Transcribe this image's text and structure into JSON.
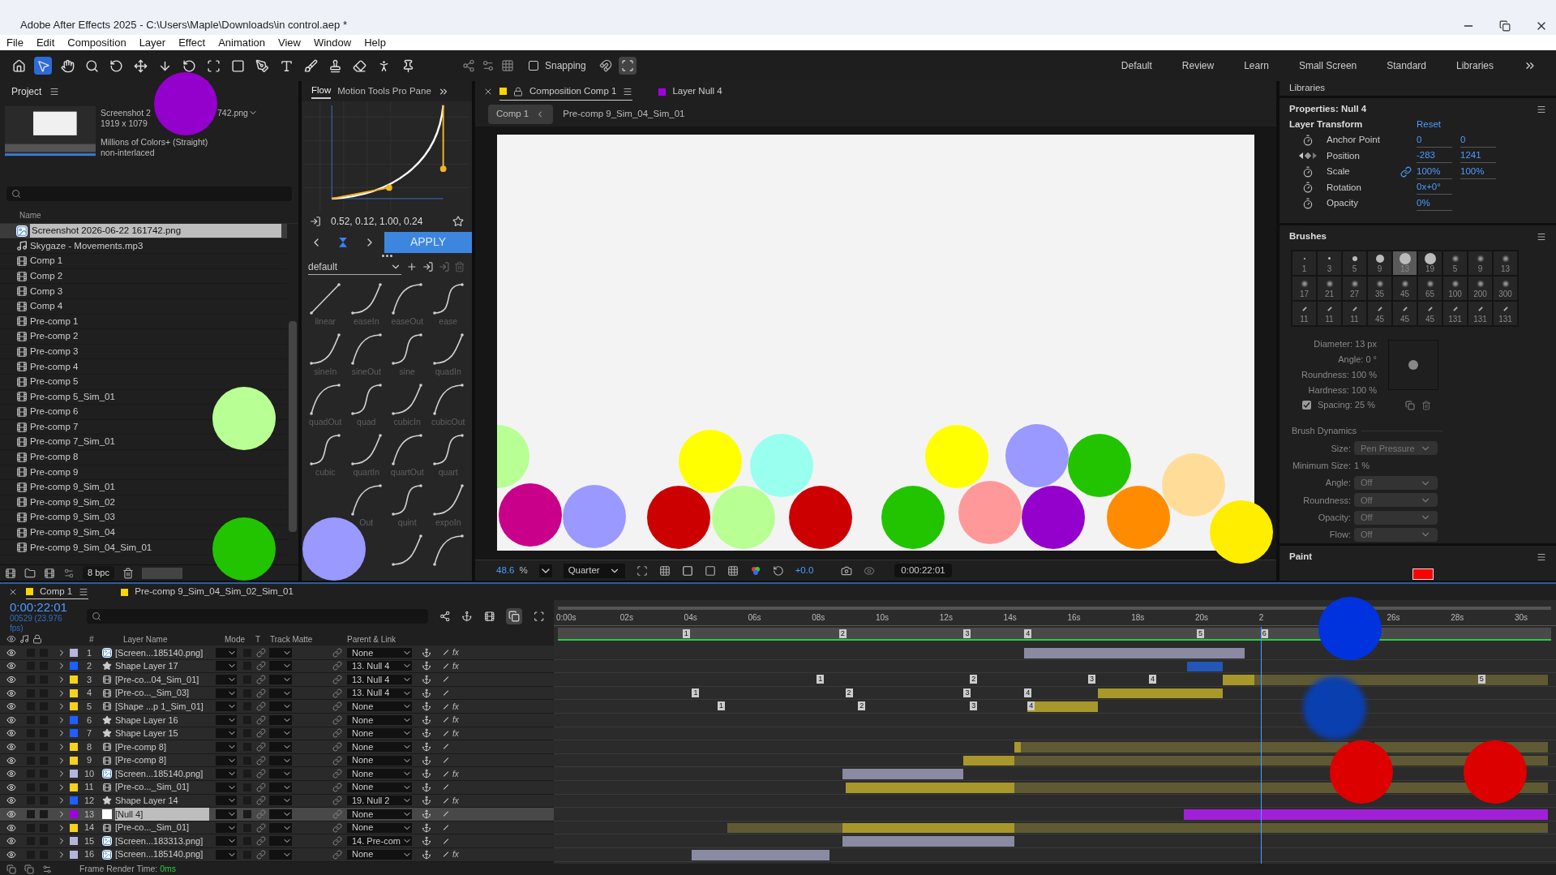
{
  "window": {
    "title": "Adobe After Effects 2025 - C:\\Users\\Maple\\Downloads\\in control.aep *"
  },
  "menu": [
    "File",
    "Edit",
    "Composition",
    "Layer",
    "Effect",
    "Animation",
    "View",
    "Window",
    "Help"
  ],
  "toolbar": {
    "snapping": {
      "label": "Snapping",
      "checked": false
    },
    "workspaces": [
      "Default",
      "Review",
      "Learn",
      "Small Screen",
      "Standard",
      "Libraries"
    ]
  },
  "project": {
    "title": "Project",
    "preview": {
      "name_start": "Screenshot 2",
      "name_end": "742.png",
      "dims": "1919 x 1079",
      "colors": "Millions of Colors+ (Straight)",
      "interlace": "non-interlaced"
    },
    "column": "Name",
    "bpc": "8 bpc",
    "items": [
      {
        "name": "Screenshot 2026-06-22 161742.png",
        "kind": "image",
        "selected": true
      },
      {
        "name": "Skygaze - Movements.mp3",
        "kind": "audio",
        "selected": false
      },
      {
        "name": "Comp 1",
        "kind": "comp",
        "selected": false
      },
      {
        "name": "Comp 2",
        "kind": "comp",
        "selected": false
      },
      {
        "name": "Comp 3",
        "kind": "comp",
        "selected": false
      },
      {
        "name": "Comp 4",
        "kind": "comp",
        "selected": false
      },
      {
        "name": "Pre-comp 1",
        "kind": "comp",
        "selected": false
      },
      {
        "name": "Pre-comp 2",
        "kind": "comp",
        "selected": false
      },
      {
        "name": "Pre-comp 3",
        "kind": "comp",
        "selected": false
      },
      {
        "name": "Pre-comp 4",
        "kind": "comp",
        "selected": false
      },
      {
        "name": "Pre-comp 5",
        "kind": "comp",
        "selected": false
      },
      {
        "name": "Pre-comp 5_Sim_01",
        "kind": "comp",
        "selected": false
      },
      {
        "name": "Pre-comp 6",
        "kind": "comp",
        "selected": false
      },
      {
        "name": "Pre-comp 7",
        "kind": "comp",
        "selected": false
      },
      {
        "name": "Pre-comp 7_Sim_01",
        "kind": "comp",
        "selected": false
      },
      {
        "name": "Pre-comp 8",
        "kind": "comp",
        "selected": false
      },
      {
        "name": "Pre-comp 9",
        "kind": "comp",
        "selected": false
      },
      {
        "name": "Pre-comp 9_Sim_01",
        "kind": "comp",
        "selected": false
      },
      {
        "name": "Pre-comp 9_Sim_02",
        "kind": "comp",
        "selected": false
      },
      {
        "name": "Pre-comp 9_Sim_03",
        "kind": "comp",
        "selected": false
      },
      {
        "name": "Pre-comp 9_Sim_04",
        "kind": "comp",
        "selected": false
      },
      {
        "name": "Pre-comp 9_Sim_04_Sim_01",
        "kind": "comp",
        "selected": false
      }
    ]
  },
  "flow": {
    "tabs": [
      {
        "label": "Flow",
        "selected": true
      },
      {
        "label": "Motion Tools Pro Pane",
        "selected": false
      }
    ],
    "values": "0.52, 0.12, 1.00, 0.24",
    "apply": "APPLY",
    "preset": "default",
    "presets": [
      "linear",
      "easeIn",
      "easeOut",
      "ease",
      "sineIn",
      "sineOut",
      "sine",
      "quadIn",
      "quadOut",
      "quad",
      "cubicIn",
      "cubicOut",
      "cubic",
      "quartIn",
      "quartOut",
      "quart",
      "Out",
      "quint",
      "expoIn"
    ]
  },
  "composition": {
    "tabs": [
      {
        "label": "Composition Comp 1",
        "color": "#ffd400",
        "selected": true
      },
      {
        "label": "Layer Null 4",
        "color": "#a100e0",
        "selected": false
      }
    ],
    "breadcrumbs": [
      "Comp 1",
      "Pre-comp 9_Sim_04_Sim_01"
    ],
    "zoom": "48.6",
    "zoom_unit": "%",
    "resolution": "Quarter",
    "exposure": "+0.0",
    "timecode": "0:00:22:01"
  },
  "right_panel": {
    "libraries": "Libraries",
    "properties": {
      "title": "Properties: Null 4",
      "section": "Layer Transform",
      "reset": "Reset",
      "rows": [
        {
          "label": "Anchor Point",
          "kind": "stopwatch",
          "values": [
            "0",
            "0"
          ],
          "linked": false
        },
        {
          "label": "Position",
          "kind": "keyframe",
          "values": [
            "-283",
            "1241"
          ],
          "linked": false
        },
        {
          "label": "Scale",
          "kind": "stopwatch",
          "values": [
            "100%",
            "100%"
          ],
          "linked": true
        },
        {
          "label": "Rotation",
          "kind": "stopwatch",
          "values": [
            "0x+0°"
          ],
          "linked": false
        },
        {
          "label": "Opacity",
          "kind": "stopwatch",
          "values": [
            "0%"
          ],
          "linked": false
        }
      ]
    },
    "brushes": {
      "title": "Brushes",
      "tips": [
        {
          "label": "1",
          "kind": "hard",
          "selected": false
        },
        {
          "label": "3",
          "kind": "hard",
          "selected": false
        },
        {
          "label": "5",
          "kind": "hard",
          "selected": false
        },
        {
          "label": "9",
          "kind": "hard",
          "selected": false
        },
        {
          "label": "13",
          "kind": "hard",
          "selected": true
        },
        {
          "label": "19",
          "kind": "hard",
          "selected": false
        },
        {
          "label": "5",
          "kind": "soft",
          "selected": false
        },
        {
          "label": "9",
          "kind": "soft",
          "selected": false
        },
        {
          "label": "13",
          "kind": "soft",
          "selected": false
        },
        {
          "label": "17",
          "kind": "soft",
          "selected": false
        },
        {
          "label": "21",
          "kind": "soft",
          "selected": false
        },
        {
          "label": "27",
          "kind": "soft",
          "selected": false
        },
        {
          "label": "35",
          "kind": "soft",
          "selected": false
        },
        {
          "label": "45",
          "kind": "soft",
          "selected": false
        },
        {
          "label": "65",
          "kind": "soft",
          "selected": false
        },
        {
          "label": "100",
          "kind": "soft",
          "selected": false
        },
        {
          "label": "200",
          "kind": "soft",
          "selected": false
        },
        {
          "label": "300",
          "kind": "soft",
          "selected": false
        },
        {
          "label": "11",
          "kind": "angled",
          "selected": false
        },
        {
          "label": "11",
          "kind": "angled",
          "selected": false
        },
        {
          "label": "11",
          "kind": "angled",
          "selected": false
        },
        {
          "label": "45",
          "kind": "angled",
          "selected": false
        },
        {
          "label": "45",
          "kind": "angled",
          "selected": false
        },
        {
          "label": "45",
          "kind": "angled",
          "selected": false
        },
        {
          "label": "131",
          "kind": "angled",
          "selected": false
        },
        {
          "label": "131",
          "kind": "angled",
          "selected": false
        },
        {
          "label": "131",
          "kind": "angled",
          "selected": false
        }
      ],
      "settings": [
        "Diameter: 13 px",
        "Angle: 0 °",
        "Roundness: 100 %",
        "Hardness: 100 %"
      ],
      "spacing": {
        "label": "Spacing: 25 %",
        "checked": true
      },
      "dynamics_title": "Brush Dynamics",
      "dynamics": [
        {
          "label": "Size:",
          "value": "Pen Pressure",
          "kind": "select"
        },
        {
          "label": "Minimum Size:",
          "value": "1 %",
          "kind": "text"
        },
        {
          "label": "Angle:",
          "value": "Off",
          "kind": "select"
        },
        {
          "label": "Roundness:",
          "value": "Off",
          "kind": "select"
        },
        {
          "label": "Opacity:",
          "value": "Off",
          "kind": "select"
        },
        {
          "label": "Flow:",
          "value": "Off",
          "kind": "select"
        }
      ]
    },
    "paint": {
      "title": "Paint",
      "color": "#ff0000"
    }
  },
  "timeline": {
    "tabs": [
      {
        "label": "Comp 1",
        "color": "#ffd400",
        "selected": true
      },
      {
        "label": "Pre-comp 9_Sim_04_Sim_02_Sim_01",
        "color": "#ffd400",
        "selected": false
      }
    ],
    "timecode": "0:00:22:01",
    "frame": "00529 (23.976 fps)",
    "columns": {
      "num": "#",
      "name": "Layer Name",
      "mode": "Mode",
      "t": "T",
      "matte": "Track Matte",
      "parent": "Parent & Link"
    },
    "ruler": [
      "0:00s",
      "02s",
      "04s",
      "06s",
      "08s",
      "10s",
      "12s",
      "14s",
      "16s",
      "18s",
      "20s",
      "2",
      "26s",
      "28s",
      "30s"
    ],
    "comp_markers": [
      "1",
      "2",
      "3",
      "4",
      "5",
      "6"
    ],
    "layers": [
      {
        "num": "1",
        "name": "[Screen...185140.png]",
        "kind": "footage",
        "color": "#b4b4dc",
        "parent": "None",
        "fx": "fx",
        "selected": false
      },
      {
        "num": "2",
        "name": "Shape Layer 17",
        "kind": "shape",
        "color": "#1f5fff",
        "parent": "13. Null 4",
        "fx": "fx",
        "selected": false
      },
      {
        "num": "3",
        "name": "[Pre-co...04_Sim_01]",
        "kind": "precomp",
        "color": "#f5d21b",
        "parent": "13. Null 4",
        "selected": false,
        "markers": [
          "1",
          "2",
          "3",
          "4",
          "5"
        ]
      },
      {
        "num": "4",
        "name": "[Pre-co..._Sim_03]",
        "kind": "precomp",
        "color": "#f5d21b",
        "parent": "13. Null 4",
        "selected": false,
        "markers": [
          "1",
          "2",
          "3",
          "4"
        ]
      },
      {
        "num": "5",
        "name": "[Shape ...p 1_Sim_01]",
        "kind": "precomp",
        "color": "#f5d21b",
        "parent": "None",
        "fx": "fx",
        "selected": false,
        "markers": [
          "1",
          "2",
          "3",
          "4"
        ]
      },
      {
        "num": "6",
        "name": "Shape Layer 16",
        "kind": "shape",
        "color": "#1f5fff",
        "parent": "None",
        "fx": "fx",
        "selected": false
      },
      {
        "num": "7",
        "name": "Shape Layer 15",
        "kind": "shape",
        "color": "#1f5fff",
        "parent": "None",
        "fx": "fx",
        "selected": false
      },
      {
        "num": "8",
        "name": "[Pre-comp 8]",
        "kind": "precomp",
        "color": "#f5d21b",
        "parent": "None",
        "selected": false
      },
      {
        "num": "9",
        "name": "[Pre-comp 8]",
        "kind": "precomp",
        "color": "#f5d21b",
        "parent": "None",
        "selected": false
      },
      {
        "num": "10",
        "name": "[Screen...185140.png]",
        "kind": "footage",
        "color": "#b4b4dc",
        "parent": "None",
        "fx": "fx",
        "selected": false
      },
      {
        "num": "11",
        "name": "[Pre-co..._Sim_01]",
        "kind": "precomp",
        "color": "#f5d21b",
        "parent": "None",
        "selected": false
      },
      {
        "num": "12",
        "name": "Shape Layer 14",
        "kind": "shape",
        "color": "#1f5fff",
        "parent": "19. Null 2",
        "fx": "fx",
        "selected": false
      },
      {
        "num": "13",
        "name": "[Null 4]",
        "kind": "null",
        "color": "#a100e0",
        "parent": "None",
        "selected": true
      },
      {
        "num": "14",
        "name": "[Pre-co..._Sim_01]",
        "kind": "precomp",
        "color": "#f5d21b",
        "parent": "None",
        "selected": false
      },
      {
        "num": "15",
        "name": "[Screen...183313.png]",
        "kind": "footage",
        "color": "#b4b4dc",
        "parent": "14. Pre-com",
        "selected": false
      },
      {
        "num": "16",
        "name": "[Screen...185140.png]",
        "kind": "footage",
        "color": "#b4b4dc",
        "parent": "None",
        "fx": "fx",
        "selected": false
      }
    ],
    "status": {
      "label": "Frame Render Time:",
      "value": "0ms"
    }
  }
}
